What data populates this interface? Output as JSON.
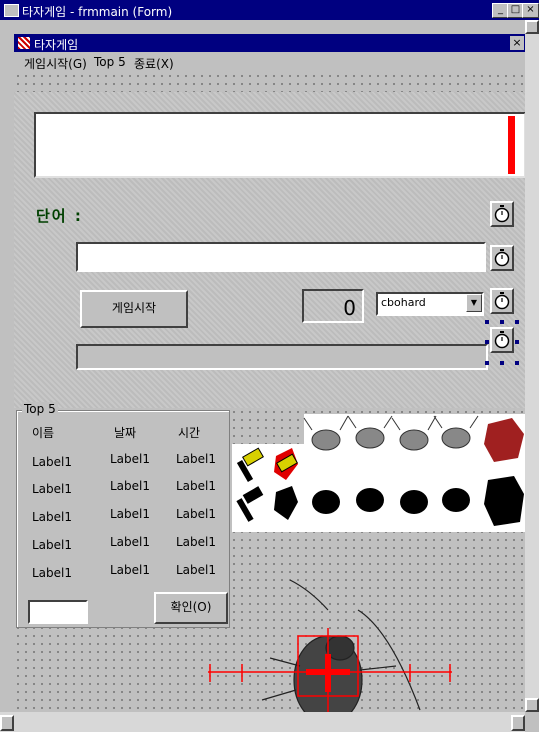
{
  "outer_window": {
    "title": "타자게임 - frmmain (Form)",
    "min": "_",
    "max": "□",
    "close": "×"
  },
  "form": {
    "title": "타자게임",
    "close": "×",
    "menu": [
      "게임시작(G)",
      "Top 5",
      "종료(X)"
    ]
  },
  "main": {
    "word_label": "단어 :",
    "word_input_value": "",
    "start_button": "게임시작",
    "counter": "0",
    "difficulty_combo": "cbohard",
    "combo_arrow": "▼"
  },
  "top5": {
    "title": "Top 5",
    "headers": [
      "이름",
      "날짜",
      "시간"
    ],
    "rows": [
      [
        "Label1",
        "Label1",
        "Label1"
      ],
      [
        "Label1",
        "Label1",
        "Label1"
      ],
      [
        "Label1",
        "Label1",
        "Label1"
      ],
      [
        "Label1",
        "Label1",
        "Label1"
      ],
      [
        "Label1",
        "Label1",
        "Label1"
      ]
    ],
    "ok_button": "확인(O)"
  },
  "icons": [
    "stopwatch-icon",
    "hammer-icon",
    "cockroach-icon",
    "crosshair-icon"
  ],
  "colors": {
    "titlebar": "#000080",
    "accent_red": "#ff0000",
    "label_green": "#004000"
  }
}
